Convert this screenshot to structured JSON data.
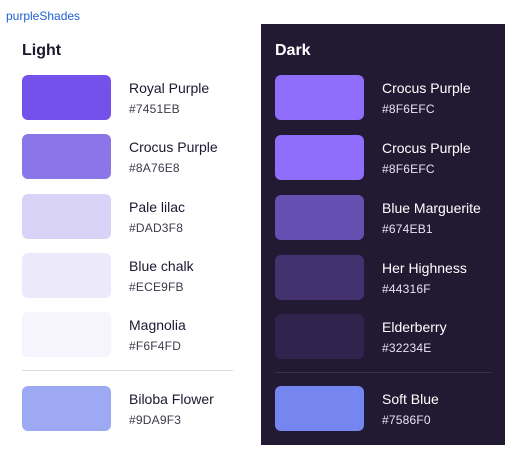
{
  "header": {
    "title": "purpleShades"
  },
  "light": {
    "title": "Light",
    "colors": [
      {
        "name": "Royal Purple",
        "hex": "#7451EB"
      },
      {
        "name": "Crocus Purple",
        "hex": "#8A76E8"
      },
      {
        "name": "Pale lilac",
        "hex": "#DAD3F8"
      },
      {
        "name": "Blue chalk",
        "hex": "#ECE9FB"
      },
      {
        "name": "Magnolia",
        "hex": "#F6F4FD"
      }
    ],
    "accent": {
      "name": "Biloba Flower",
      "hex": "#9DA9F3"
    }
  },
  "dark": {
    "title": "Dark",
    "colors": [
      {
        "name": "Crocus Purple",
        "hex": "#8F6EFC"
      },
      {
        "name": "Crocus Purple",
        "hex": "#8F6EFC"
      },
      {
        "name": "Blue Marguerite",
        "hex": "#674EB1"
      },
      {
        "name": "Her Highness",
        "hex": "#44316F"
      },
      {
        "name": "Elderberry",
        "hex": "#32234E"
      }
    ],
    "accent": {
      "name": "Soft Blue",
      "hex": "#7586F0"
    }
  }
}
